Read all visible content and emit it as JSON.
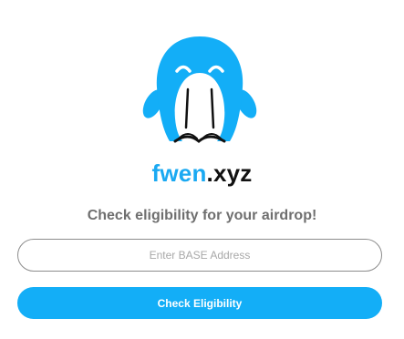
{
  "brand": {
    "primary": "fwen",
    "secondary": ".xyz",
    "accent_color": "#1aa9f2"
  },
  "logo": {
    "icon": "penguin-logo-icon"
  },
  "subtitle": "Check eligibility for your airdrop!",
  "address_input": {
    "placeholder": "Enter BASE Address",
    "value": ""
  },
  "check_button": {
    "label": "Check Eligibility",
    "color": "#13aef7"
  }
}
